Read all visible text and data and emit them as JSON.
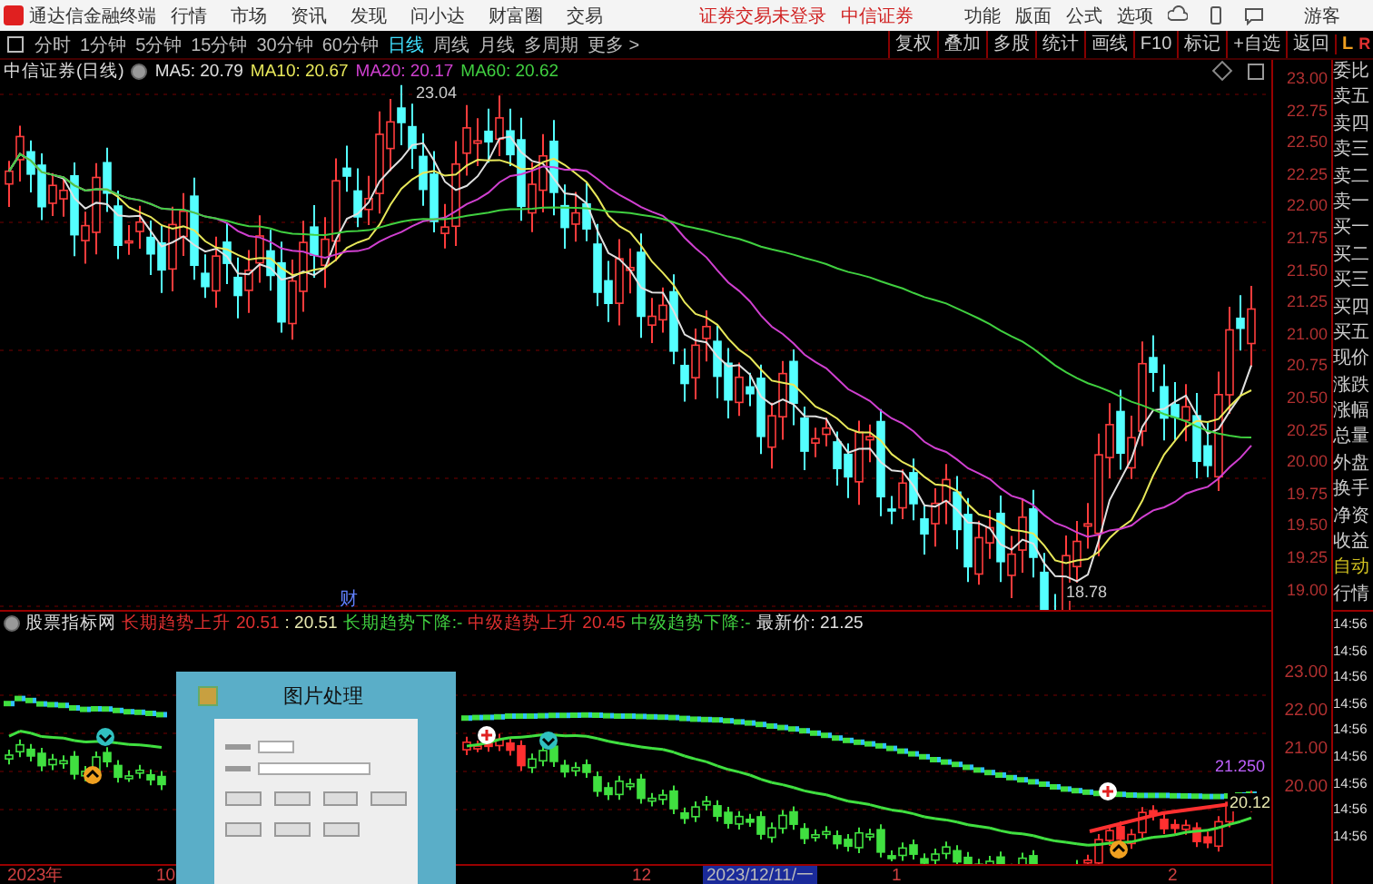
{
  "app_bar": {
    "title": "通达信金融终端",
    "menus": [
      "行情",
      "市场",
      "资讯",
      "发现",
      "问小达",
      "财富圈",
      "交易"
    ],
    "login_status": "证券交易未登录",
    "broker": "中信证券",
    "right_menus": [
      "功能",
      "版面",
      "公式",
      "选项"
    ],
    "user": "游客"
  },
  "period_tabs": [
    {
      "label": "分时",
      "selected": false
    },
    {
      "label": "1分钟",
      "selected": false
    },
    {
      "label": "5分钟",
      "selected": false
    },
    {
      "label": "15分钟",
      "selected": false
    },
    {
      "label": "30分钟",
      "selected": false
    },
    {
      "label": "60分钟",
      "selected": false
    },
    {
      "label": "日线",
      "selected": true
    },
    {
      "label": "周线",
      "selected": false
    },
    {
      "label": "月线",
      "selected": false
    },
    {
      "label": "多周期",
      "selected": false
    },
    {
      "label": "更多 >",
      "selected": false
    }
  ],
  "tools": [
    "复权",
    "叠加",
    "多股",
    "统计",
    "画线",
    "F10",
    "标记",
    "+自选",
    "返回"
  ],
  "panel_toggle": {
    "left": "L",
    "right": "R"
  },
  "main_chart": {
    "title": "中信证券(日线)",
    "legend": [
      {
        "label": "MA5: 20.79",
        "color": "#e0e0e0"
      },
      {
        "label": "MA10: 20.67",
        "color": "#e8e85a"
      },
      {
        "label": "MA20: 20.17",
        "color": "#d040d0"
      },
      {
        "label": "MA60: 20.62",
        "color": "#40d040"
      }
    ],
    "high_label": "23.04",
    "low_label": "18.78",
    "event_badge": "财",
    "axis": [
      "23.00",
      "22.75",
      "22.50",
      "22.25",
      "22.00",
      "21.75",
      "21.50",
      "21.25",
      "21.00",
      "20.75",
      "20.50",
      "20.25",
      "20.00",
      "19.75",
      "19.50",
      "19.25",
      "19.00"
    ]
  },
  "indicator": {
    "title": "股票指标网",
    "legend": [
      {
        "label": "长期趋势上升",
        "color": "#e03030"
      },
      {
        "label": "20.51",
        "color": "#e03030"
      },
      {
        "label": ": 20.51",
        "color": "#e8e8b0"
      },
      {
        "label": "长期趋势下降:-",
        "color": "#40d040"
      },
      {
        "label": "中级趋势上升",
        "color": "#e03030"
      },
      {
        "label": "20.45",
        "color": "#e03030"
      },
      {
        "label": "中级趋势下降:-",
        "color": "#40d040"
      },
      {
        "label": "最新价: 21.25",
        "color": "#e0e0e0"
      }
    ],
    "price_label": "21.250",
    "line_label": "20.12",
    "axis": [
      "23.00",
      "22.00",
      "21.00",
      "20.00"
    ]
  },
  "date_axis": [
    {
      "label": "2023年",
      "selected": false
    },
    {
      "label": "10",
      "selected": false
    },
    {
      "label": "12",
      "selected": false
    },
    {
      "label": "2023/12/11/一",
      "selected": true
    },
    {
      "label": "1",
      "selected": false
    },
    {
      "label": "2",
      "selected": false
    }
  ],
  "quote_panel": {
    "labels": [
      "委比",
      "卖五",
      "卖四",
      "卖三",
      "卖二",
      "卖一",
      "买一",
      "买二",
      "买三",
      "买四",
      "买五",
      "现价",
      "涨跌",
      "涨幅",
      "总量",
      "外盘",
      "换手",
      "净资",
      "收益",
      "自动",
      "行情"
    ],
    "times": [
      "14:56",
      "14:56",
      "14:56",
      "14:56",
      "14:56",
      "14:56",
      "14:56",
      "14:56",
      "14:56"
    ]
  },
  "dialog": {
    "title": "图片处理"
  }
}
